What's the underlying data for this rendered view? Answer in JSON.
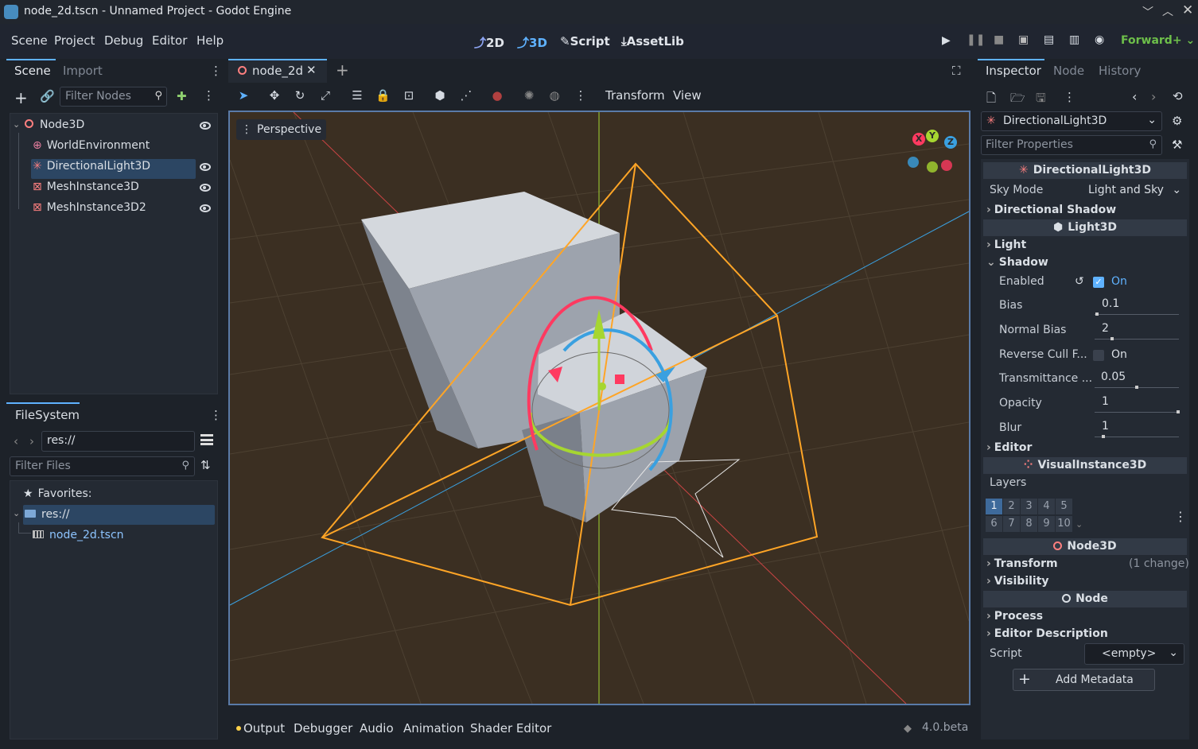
{
  "window": {
    "title": "node_2d.tscn - Unnamed Project - Godot Engine"
  },
  "menu": [
    "Scene",
    "Project",
    "Debug",
    "Editor",
    "Help"
  ],
  "workspaces": {
    "two_d": "2D",
    "three_d": "3D",
    "script": "Script",
    "assetlib": "AssetLib"
  },
  "renderer": "Forward+",
  "scene_dock": {
    "tabs": [
      "Scene",
      "Import"
    ],
    "filter_placeholder": "Filter Nodes",
    "tree": [
      {
        "label": "Node3D"
      },
      {
        "label": "WorldEnvironment"
      },
      {
        "label": "DirectionalLight3D"
      },
      {
        "label": "MeshInstance3D"
      },
      {
        "label": "MeshInstance3D2"
      }
    ]
  },
  "filesystem": {
    "title": "FileSystem",
    "path": "res://",
    "filter_placeholder": "Filter Files",
    "favorites": "Favorites:",
    "root": "res://",
    "file": "node_2d.tscn"
  },
  "editor_tab": {
    "label": "node_2d"
  },
  "viewport_toolbar": {
    "transform": "Transform",
    "view": "View"
  },
  "viewport": {
    "perspective": "Perspective",
    "gizmo_axes": [
      "X",
      "Y",
      "Z"
    ]
  },
  "inspector": {
    "tabs": [
      "Inspector",
      "Node",
      "History"
    ],
    "object": "DirectionalLight3D",
    "filter_placeholder": "Filter Properties",
    "class_dirlight": "DirectionalLight3D",
    "sky_mode_label": "Sky Mode",
    "sky_mode_value": "Light and Sky",
    "directional_shadow": "Directional Shadow",
    "class_light": "Light3D",
    "cat_light": "Light",
    "cat_shadow": "Shadow",
    "enabled_label": "Enabled",
    "enabled_value": "On",
    "bias_label": "Bias",
    "bias_value": "0.1",
    "normal_bias_label": "Normal Bias",
    "normal_bias_value": "2",
    "reverse_cull_label": "Reverse Cull F...",
    "reverse_cull_value": "On",
    "transmittance_label": "Transmittance ...",
    "transmittance_value": "0.05",
    "opacity_label": "Opacity",
    "opacity_value": "1",
    "blur_label": "Blur",
    "blur_value": "1",
    "cat_editor": "Editor",
    "class_visual": "VisualInstance3D",
    "layers_label": "Layers",
    "layers": [
      "1",
      "2",
      "3",
      "4",
      "5",
      "6",
      "7",
      "8",
      "9",
      "10"
    ],
    "class_node3d": "Node3D",
    "cat_transform": "Transform",
    "transform_note": "(1 change)",
    "cat_visibility": "Visibility",
    "class_node": "Node",
    "cat_process": "Process",
    "cat_editor_desc": "Editor Description",
    "script_label": "Script",
    "script_value": "<empty>",
    "add_metadata": "Add Metadata"
  },
  "bottom": {
    "tabs": [
      "Output",
      "Debugger",
      "Audio",
      "Animation",
      "Shader Editor"
    ],
    "version": "4.0.beta"
  },
  "colors": {
    "accent": "#5fb2ff",
    "orange": "#ffa526",
    "selected": "#2c4663"
  }
}
